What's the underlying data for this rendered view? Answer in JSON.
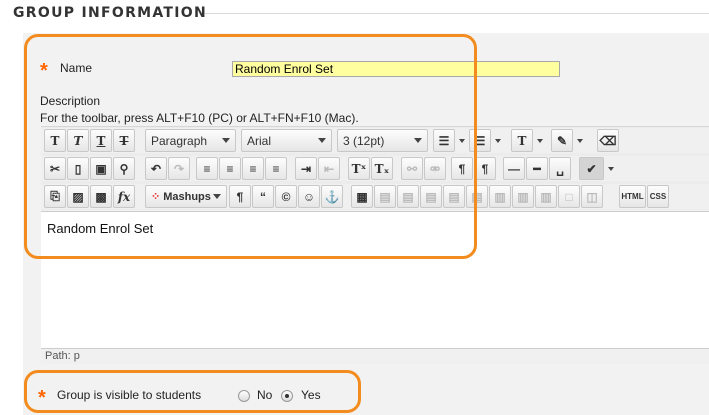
{
  "section_heading": "GROUP INFORMATION",
  "name_field": {
    "label": "Name",
    "value": "Random Enrol Set",
    "required_mark": "*"
  },
  "description": {
    "label": "Description",
    "hint": "For the toolbar, press ALT+F10 (PC) or ALT+FN+F10 (Mac)."
  },
  "toolbar": {
    "paragraph_select": "Paragraph",
    "font_select": "Arial",
    "size_select": "3 (12pt)",
    "mashups_label": "Mashups",
    "html_label": "HTML",
    "css_label": "CSS"
  },
  "editor": {
    "content": "Random Enrol Set",
    "path_label": "Path: p"
  },
  "visibility": {
    "label": "Group is visible to students",
    "required_mark": "*",
    "option_no": "No",
    "option_yes": "Yes",
    "selected": "Yes"
  },
  "colors": {
    "highlight": "#f28c1f",
    "required": "#ff6600",
    "input_bg": "#ffffa0"
  }
}
